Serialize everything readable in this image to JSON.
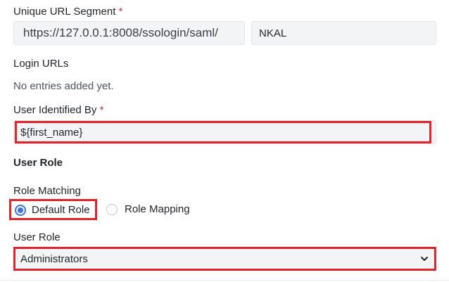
{
  "fields": {
    "unique_url_segment": {
      "label": "Unique URL Segment",
      "required_mark": "*",
      "url_prefix": "https://127.0.0.1:8008/ssologin/saml/",
      "value": "NKAL"
    },
    "login_urls": {
      "label": "Login URLs",
      "empty_text": "No entries added yet."
    },
    "user_identified_by": {
      "label": "User Identified By",
      "required_mark": "*",
      "value": "${first_name}"
    }
  },
  "user_role_section": {
    "title": "User Role",
    "role_matching": {
      "label": "Role Matching",
      "options": [
        {
          "label": "Default Role",
          "selected": true
        },
        {
          "label": "Role Mapping",
          "selected": false
        }
      ]
    },
    "user_role": {
      "label": "User Role",
      "selected_value": "Administrators"
    }
  },
  "colors": {
    "highlight": "#e2232a",
    "radio_accent": "#3b74e0",
    "required": "#d32f2f"
  },
  "icons": {
    "select_chevron": "chevron-down-icon"
  }
}
